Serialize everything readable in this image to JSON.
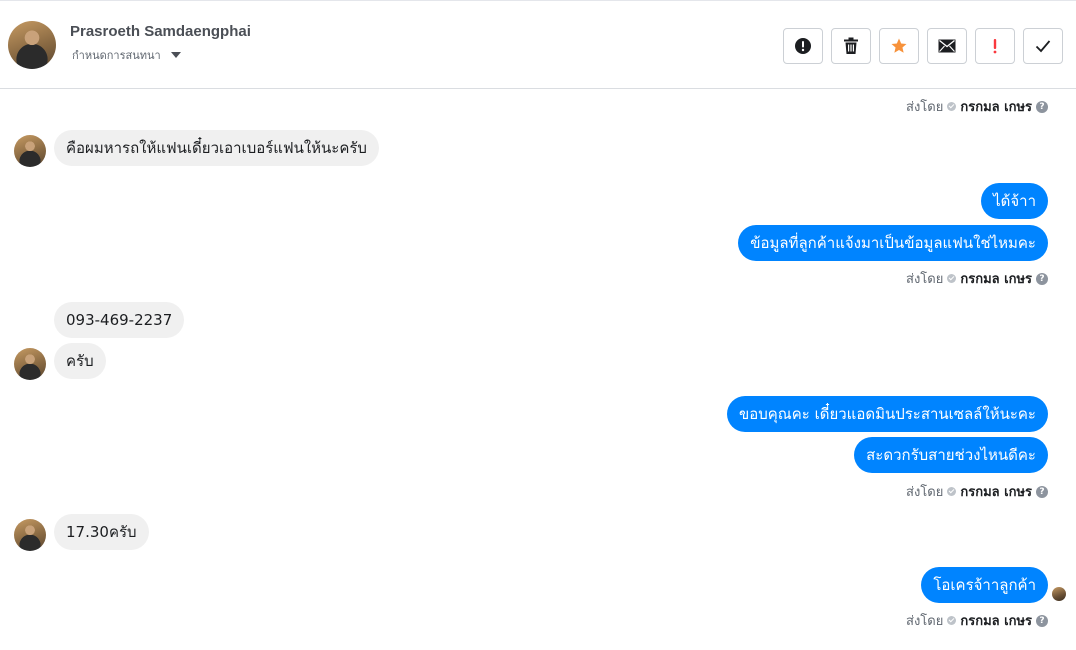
{
  "header": {
    "name": "Prasroeth Samdaengphai",
    "assign_label": "กำหนดการสนทนา"
  },
  "toolbar": [
    {
      "name": "spam-button",
      "icon": "exclamation-circle-icon"
    },
    {
      "name": "delete-button",
      "icon": "trash-icon"
    },
    {
      "name": "star-button",
      "icon": "star-icon",
      "color": "#f7923b"
    },
    {
      "name": "mark-unread-button",
      "icon": "envelope-icon"
    },
    {
      "name": "important-button",
      "icon": "exclamation-icon",
      "color": "#fa383e"
    },
    {
      "name": "done-button",
      "icon": "check-icon"
    }
  ],
  "meta": {
    "sent_by": "ส่งโดย",
    "sender": "กรกมล เกษร",
    "help": "?"
  },
  "messages": [
    {
      "side": "in",
      "text": "คือผมหารถให้แฟนเดี๋ยวเอาเบอร์แฟนให้นะครับ"
    },
    {
      "side": "out",
      "text": "ได้จ้าา"
    },
    {
      "side": "out",
      "text": "ข้อมูลที่ลูกค้าแจ้งมาเป็นข้อมูลแฟนใช่ไหมคะ"
    },
    {
      "side": "in",
      "text": "093-469-2237"
    },
    {
      "side": "in",
      "text": "ครับ"
    },
    {
      "side": "out",
      "text": "ขอบคุณคะ เดี๋ยวแอดมินประสานเซลล์ให้นะคะ"
    },
    {
      "side": "out",
      "text": "สะดวกรับสายช่วงไหนดีคะ"
    },
    {
      "side": "in",
      "text": "17.30ครับ"
    },
    {
      "side": "out",
      "text": "โอเครจ้าาลูกค้า"
    }
  ],
  "colors": {
    "outgoing_bubble": "#0084ff",
    "incoming_bubble": "#f0f0f0"
  }
}
